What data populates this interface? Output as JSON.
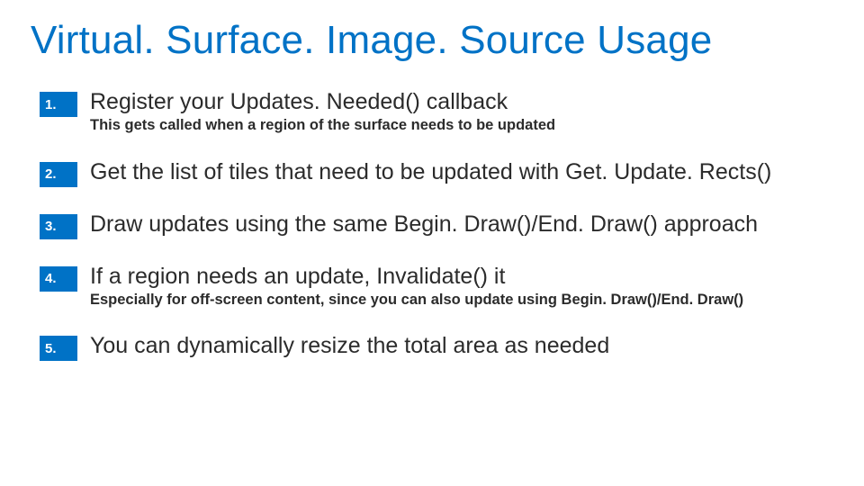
{
  "title": "Virtual. Surface. Image. Source Usage",
  "items": [
    {
      "num": "1.",
      "main": "Register your Updates. Needed() callback",
      "sub": "This gets called when a region of the surface needs to be updated"
    },
    {
      "num": "2.",
      "main": "Get the list of tiles that need to be updated with Get. Update. Rects()",
      "sub": ""
    },
    {
      "num": "3.",
      "main": "Draw updates using the same Begin. Draw()/End. Draw() approach",
      "sub": ""
    },
    {
      "num": "4.",
      "main": "If a region needs an update, Invalidate() it",
      "sub": "Especially for off-screen content, since you can also update using Begin. Draw()/End. Draw()"
    },
    {
      "num": "5.",
      "main": "You can dynamically resize the total area as needed",
      "sub": ""
    }
  ]
}
